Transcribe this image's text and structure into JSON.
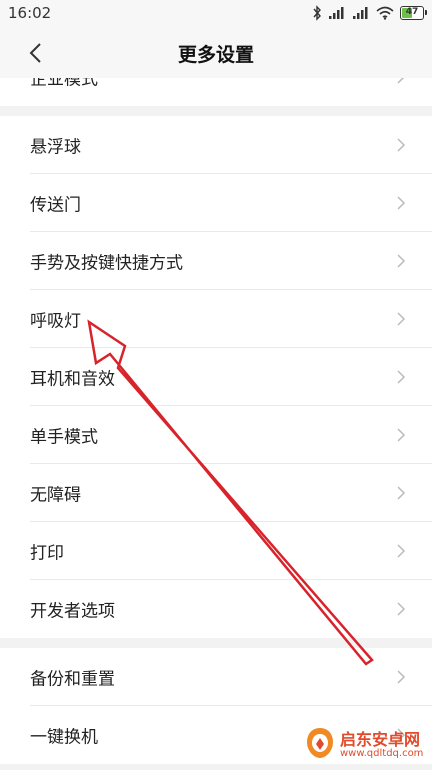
{
  "status_bar": {
    "time": "16:02",
    "battery": "47"
  },
  "header": {
    "title": "更多设置"
  },
  "partial_item": {
    "label": "企业模式"
  },
  "group1": {
    "items": [
      {
        "label": "悬浮球"
      },
      {
        "label": "传送门"
      },
      {
        "label": "手势及按键快捷方式"
      },
      {
        "label": "呼吸灯"
      },
      {
        "label": "耳机和音效"
      },
      {
        "label": "单手模式"
      },
      {
        "label": "无障碍"
      },
      {
        "label": "打印"
      },
      {
        "label": "开发者选项"
      }
    ]
  },
  "group2": {
    "items": [
      {
        "label": "备份和重置"
      },
      {
        "label": "一键换机"
      }
    ]
  },
  "watermark": {
    "title": "启东安卓网",
    "url": "www.qdltdq.com"
  },
  "colors": {
    "annotation_arrow": "#d8232a",
    "background": "#f2f2f2",
    "watermark": "#e14b2b"
  }
}
